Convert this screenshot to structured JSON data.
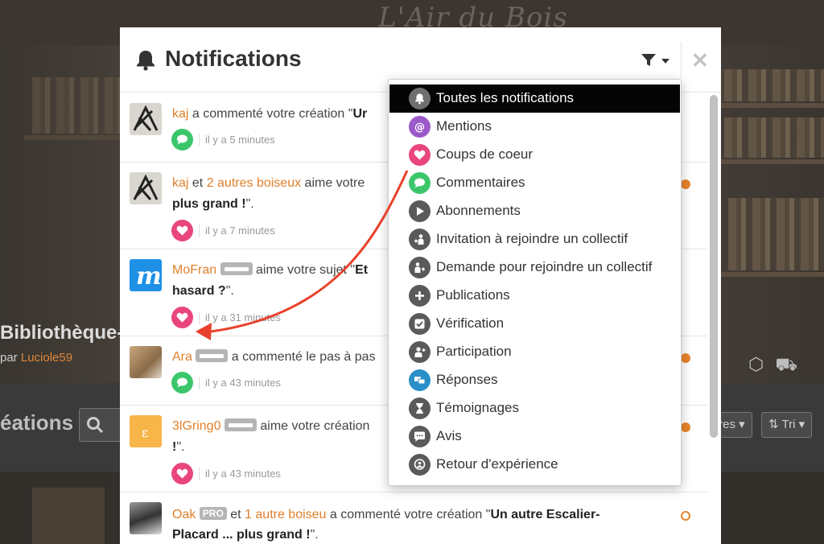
{
  "background": {
    "logo": "L'Air du Bois",
    "project_title": "Bibliothèque-",
    "by_prefix": "par",
    "author": "Luciole59",
    "section_label": "éations",
    "filter_fragment": "tres",
    "sort_label": "Tri"
  },
  "modal": {
    "title": "Notifications",
    "close_symbol": "✕"
  },
  "notifications": [
    {
      "id": 1,
      "parts": [
        {
          "t": "user",
          "v": "kaj"
        },
        {
          "t": "text",
          "v": " a commenté votre création \""
        },
        {
          "t": "bold",
          "v": "Ur"
        }
      ],
      "line2": [],
      "type": "comment",
      "time": "il y a 5 minutes",
      "unread": false
    },
    {
      "id": 2,
      "parts": [
        {
          "t": "user",
          "v": "kaj"
        },
        {
          "t": "text",
          "v": " et "
        },
        {
          "t": "user",
          "v": "2 autres boiseux"
        },
        {
          "t": "text",
          "v": " aime votre"
        }
      ],
      "line2": [
        {
          "t": "bold",
          "v": "plus grand !"
        },
        {
          "t": "text",
          "v": "\"."
        }
      ],
      "type": "like",
      "time": "il y a 7 minutes",
      "unread": true
    },
    {
      "id": 3,
      "parts": [
        {
          "t": "user",
          "v": "MoFran"
        },
        {
          "t": "badge",
          "v": ""
        },
        {
          "t": "text",
          "v": " aime votre sujet \""
        },
        {
          "t": "bold",
          "v": "Et"
        }
      ],
      "line2": [
        {
          "t": "bold",
          "v": "hasard ?"
        },
        {
          "t": "text",
          "v": "\"."
        }
      ],
      "type": "like",
      "time": "il y a 31 minutes",
      "unread": false
    },
    {
      "id": 4,
      "parts": [
        {
          "t": "user",
          "v": "Ara"
        },
        {
          "t": "badge",
          "v": ""
        },
        {
          "t": "text",
          "v": " a commenté le pas à pas"
        }
      ],
      "line2": [],
      "type": "comment",
      "time": "il y a 43 minutes",
      "unread": true
    },
    {
      "id": 5,
      "parts": [
        {
          "t": "user",
          "v": "3lGring0"
        },
        {
          "t": "badge",
          "v": ""
        },
        {
          "t": "text",
          "v": " aime votre création"
        }
      ],
      "line2": [
        {
          "t": "bold",
          "v": "!"
        },
        {
          "t": "text",
          "v": "\"."
        }
      ],
      "type": "like",
      "time": "il y a 43 minutes",
      "unread": true
    },
    {
      "id": 6,
      "parts": [
        {
          "t": "user",
          "v": "Oak"
        },
        {
          "t": "pro",
          "v": "PRO"
        },
        {
          "t": "text",
          "v": " et "
        },
        {
          "t": "user",
          "v": "1 autre boiseu"
        },
        {
          "t": "text",
          "v": " a commenté votre création \""
        },
        {
          "t": "bold",
          "v": "Un autre Escalier-"
        }
      ],
      "line2": [
        {
          "t": "bold",
          "v": "Placard ... plus grand !"
        },
        {
          "t": "text",
          "v": "\"."
        }
      ],
      "type": "comment",
      "time": "",
      "unread": "hollow"
    }
  ],
  "filter_menu": [
    {
      "label": "Toutes les notifications",
      "icon": "bell-icon",
      "color": "#6f6f6f",
      "active": true
    },
    {
      "label": "Mentions",
      "icon": "at-icon",
      "color": "#9b59c9",
      "active": false
    },
    {
      "label": "Coups de coeur",
      "icon": "heart-icon",
      "color": "#e8467c",
      "active": false
    },
    {
      "label": "Commentaires",
      "icon": "comment-icon",
      "color": "#3cc66b",
      "active": false
    },
    {
      "label": "Abonnements",
      "icon": "play-icon",
      "color": "#5a5a5a",
      "active": false
    },
    {
      "label": "Invitation à rejoindre un collectif",
      "icon": "invite-icon",
      "color": "#5a5a5a",
      "active": false
    },
    {
      "label": "Demande pour rejoindre un collectif",
      "icon": "request-icon",
      "color": "#5a5a5a",
      "active": false
    },
    {
      "label": "Publications",
      "icon": "plus-icon",
      "color": "#5a5a5a",
      "active": false
    },
    {
      "label": "Vérification",
      "icon": "check-icon",
      "color": "#5a5a5a",
      "active": false
    },
    {
      "label": "Participation",
      "icon": "participation-icon",
      "color": "#5a5a5a",
      "active": false
    },
    {
      "label": "Réponses",
      "icon": "replies-icon",
      "color": "#2a8fc8",
      "active": false
    },
    {
      "label": "Témoignages",
      "icon": "hourglass-icon",
      "color": "#5a5a5a",
      "active": false
    },
    {
      "label": "Avis",
      "icon": "review-icon",
      "color": "#5a5a5a",
      "active": false
    },
    {
      "label": "Retour d'expérience",
      "icon": "feedback-icon",
      "color": "#5a5a5a",
      "active": false
    }
  ],
  "colors": {
    "accent": "#e0802c",
    "like": "#e8467c",
    "comment": "#3cc66b",
    "arrow": "#e8422c"
  }
}
